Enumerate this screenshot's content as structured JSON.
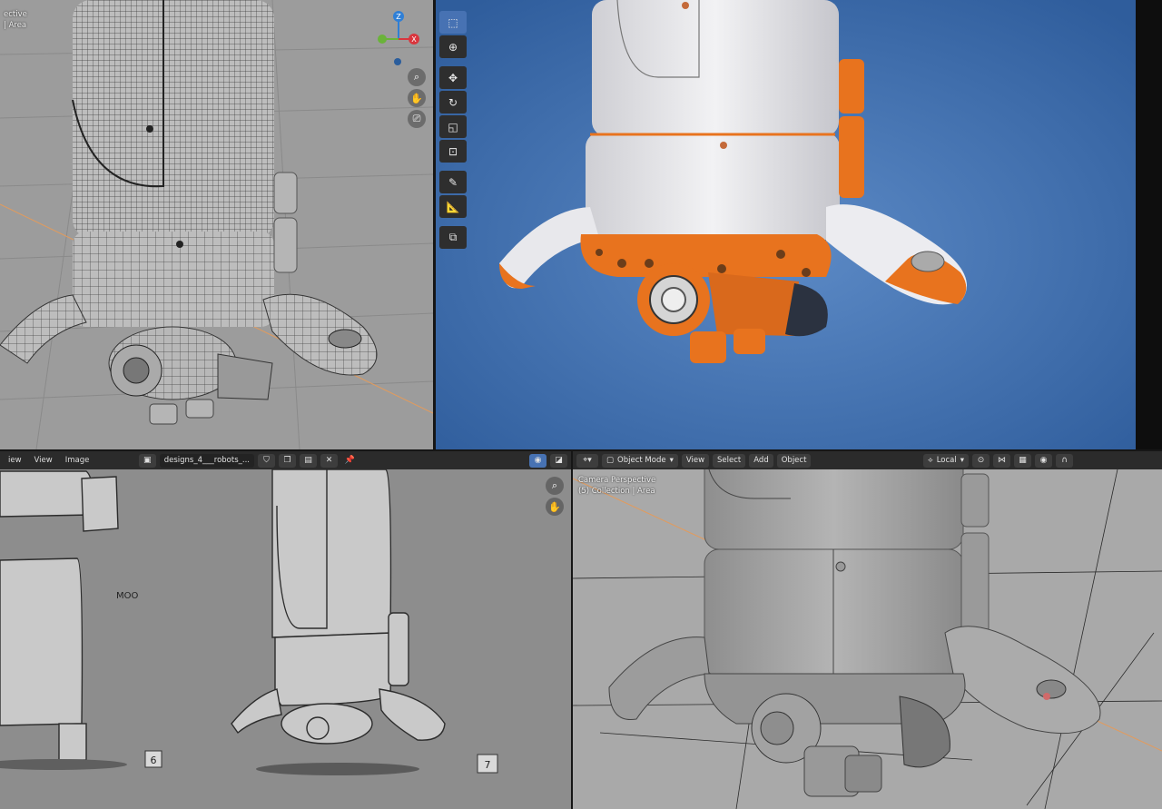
{
  "top_left": {
    "overlay_line1": "ective",
    "overlay_line2": "| Area",
    "gizmo": {
      "z_label": "Z",
      "x_label": "X",
      "z_color": "#2f7fd6",
      "x_color": "#d9363e",
      "y_color": "#6ab33a"
    },
    "nav_icons": [
      "zoom-icon",
      "hand-icon",
      "camera-icon"
    ]
  },
  "top_right": {
    "toolbar": [
      "select-box-icon",
      "cursor-icon",
      "move-icon",
      "rotate-icon",
      "scale-icon",
      "transform-icon",
      "annotate-icon",
      "measure-icon",
      "add-cube-icon"
    ],
    "background_color": "#3f6fb3",
    "accent_color": "#e8731e"
  },
  "bottom_left": {
    "header": {
      "menu_partial": "iew",
      "view_label": "View",
      "image_label": "Image",
      "image_name": "designs_4___robots_..."
    },
    "sketch_text": {
      "moo": "MOO",
      "label6": "6",
      "label7": "7"
    }
  },
  "bottom_right": {
    "header": {
      "mode_label": "Object Mode",
      "view_label": "View",
      "select_label": "Select",
      "add_label": "Add",
      "object_label": "Object",
      "orientation_label": "Local"
    },
    "overlay_line1": "Camera Perspective",
    "overlay_line2": "(5) Collection | Area"
  }
}
